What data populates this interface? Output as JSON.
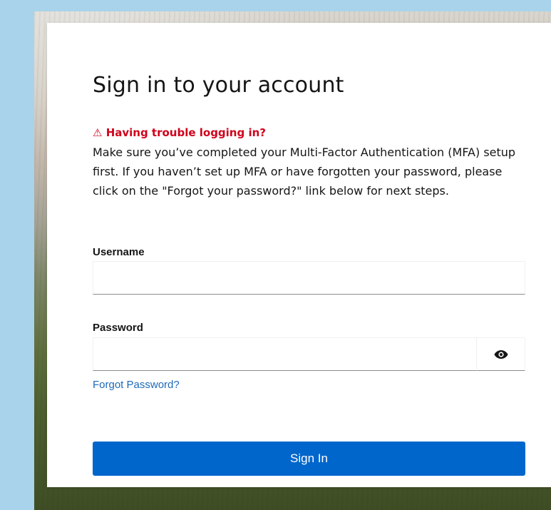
{
  "page": {
    "title": "Sign in to your account"
  },
  "alert": {
    "icon": "warning-triangle-icon",
    "title": "Having trouble logging in?",
    "message": "Make sure you’ve completed your Multi-Factor Authentication (MFA) setup first. If you haven’t set up MFA or have forgotten your password, please click on the \"Forgot your password?\" link below for next steps.",
    "color": "#d0021b"
  },
  "form": {
    "username_label": "Username",
    "username_value": "",
    "password_label": "Password",
    "password_value": "",
    "show_password_icon": "eye-icon",
    "forgot_password_link": "Forgot Password?",
    "sign_in_label": "Sign In"
  },
  "colors": {
    "background": "#a9d3ea",
    "primary_button": "#0066cc",
    "link": "#1d6ab8"
  }
}
